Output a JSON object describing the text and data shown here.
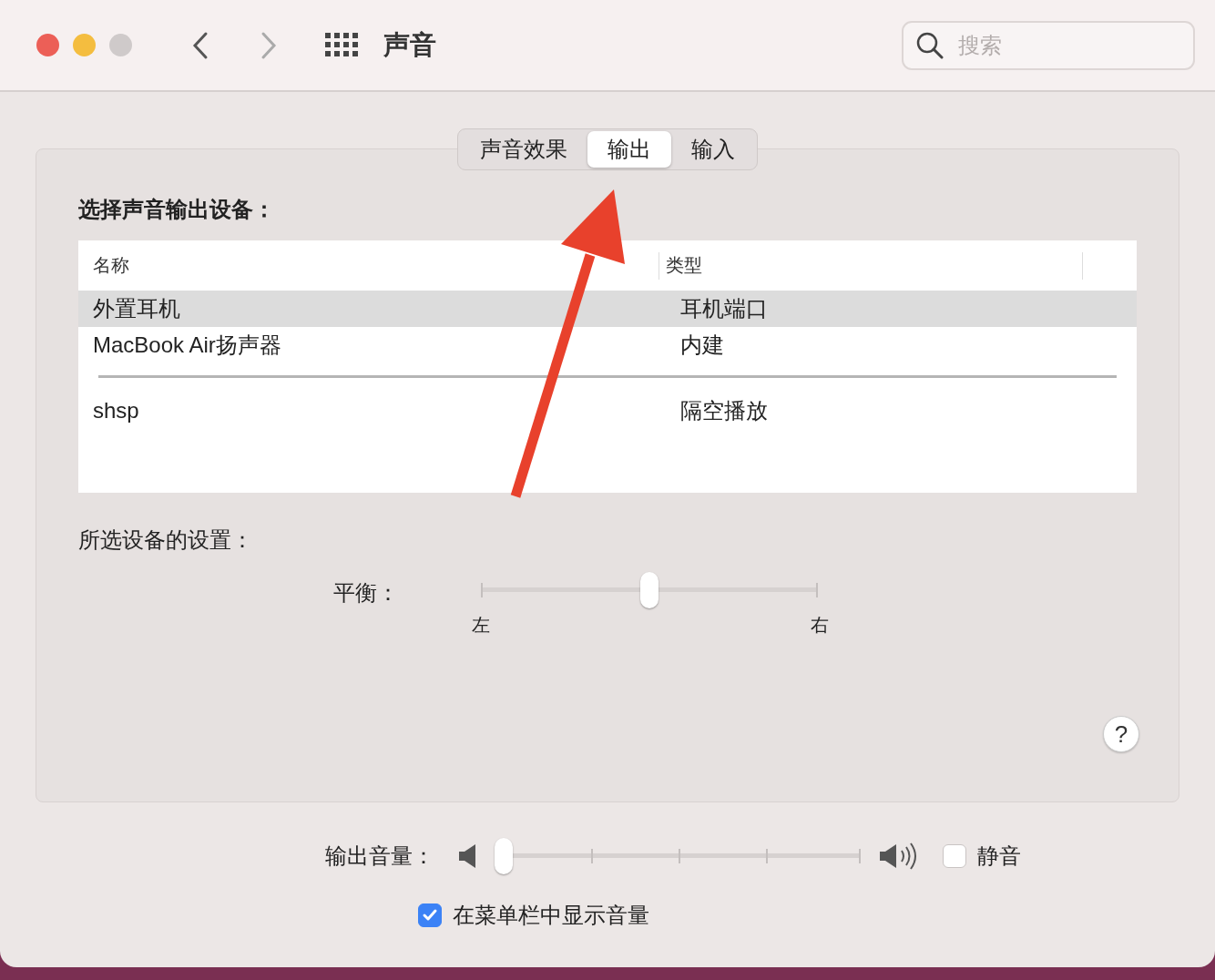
{
  "window": {
    "title": "声音",
    "search": {
      "placeholder": "搜索"
    }
  },
  "tabs": [
    {
      "label": "声音效果",
      "selected": false
    },
    {
      "label": "输出",
      "selected": true
    },
    {
      "label": "输入",
      "selected": false
    }
  ],
  "output": {
    "heading": "选择声音输出设备：",
    "columns": [
      "名称",
      "类型"
    ],
    "device_groups": [
      [
        {
          "name": "外置耳机",
          "type": "耳机端口",
          "selected": true
        },
        {
          "name": "MacBook Air扬声器",
          "type": "内建",
          "selected": false
        }
      ],
      [
        {
          "name": "shsp",
          "type": "隔空播放",
          "selected": false
        }
      ]
    ]
  },
  "settings": {
    "heading": "所选设备的设置：",
    "balance": {
      "label": "平衡：",
      "level": 0.5,
      "left": "左",
      "right": "右"
    },
    "help": "?"
  },
  "volume": {
    "label": "输出音量：",
    "level": 0,
    "mute": {
      "label": "静音",
      "checked": false
    }
  },
  "menu_bar_volume": {
    "label": "在菜单栏中显示音量",
    "checked": true
  }
}
